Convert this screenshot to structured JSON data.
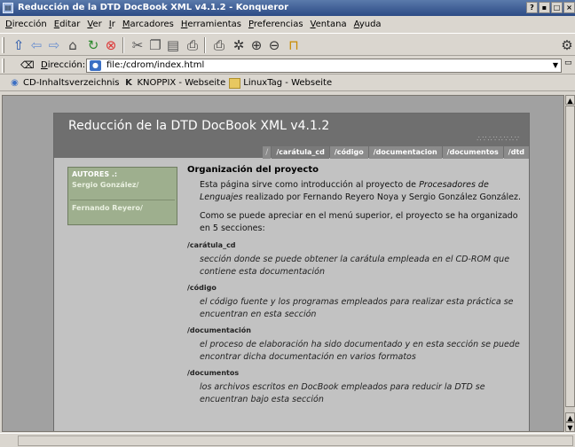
{
  "window": {
    "title": "Reducción de la DTD DocBook XML v4.1.2 - Konqueror",
    "buttons": [
      "?",
      "▪",
      "□",
      "×"
    ]
  },
  "menubar": [
    {
      "u": "D",
      "rest": "irección"
    },
    {
      "u": "E",
      "rest": "ditar"
    },
    {
      "u": "V",
      "rest": "er"
    },
    {
      "u": "I",
      "rest": "r"
    },
    {
      "u": "M",
      "rest": "arcadores"
    },
    {
      "u": "H",
      "rest": "erramientas"
    },
    {
      "u": "P",
      "rest": "referencias"
    },
    {
      "u": "V",
      "rest": "entana"
    },
    {
      "u": "A",
      "rest": "yuda"
    }
  ],
  "toolbar": {
    "icons": [
      "up-arrow-icon",
      "back-arrow-icon",
      "forward-arrow-icon",
      "home-icon",
      "reload-icon",
      "stop-icon",
      "cut-icon",
      "copy-icon",
      "paste-icon",
      "print-icon",
      "print-frame-icon",
      "security-icon",
      "zoom-in-icon",
      "zoom-out-icon",
      "lock-icon"
    ]
  },
  "urlbar": {
    "label_u": "D",
    "label_rest": "irección:",
    "value": "file:/cdrom/index.html"
  },
  "bookmarks": [
    {
      "icon": "cd-icon",
      "label": "CD-Inhaltsverzeichnis"
    },
    {
      "icon": "knoppix-icon",
      "label": "KNOPPIX - Webseite"
    },
    {
      "icon": "folder-icon",
      "label": "LinuxTag - Webseite"
    }
  ],
  "page": {
    "title": "Reducción de la DTD DocBook XML v4.1.2",
    "nav_sep": "/",
    "nav": [
      "/carátula_cd",
      "/código",
      "/documentacion",
      "/documentos",
      "/dtd"
    ],
    "sidebar": {
      "header": "AUTORES .:",
      "authors": [
        "Sergio González/",
        "Fernando Reyero/"
      ]
    },
    "heading": "Organización del proyecto",
    "intro1_pre": "Esta página sirve como introducción al proyecto de ",
    "intro1_em": "Procesadores de Lenguajes",
    "intro1_post": " realizado por Fernando Reyero Noya y Sergio González González.",
    "intro2": "Como se puede apreciar en el menú superior, el proyecto se ha organizado en 5 secciones:",
    "sections": [
      {
        "name": "/carátula_cd",
        "desc": "sección donde se puede obtener la carátula empleada en el CD-ROM que contiene esta documentación"
      },
      {
        "name": "/código",
        "desc": "el código fuente y los programas empleados para realizar esta práctica se encuentran en esta sección"
      },
      {
        "name": "/documentación",
        "desc": "el proceso de elaboración ha sido documentado y en esta sección se puede encontrar dicha documentación en varios formatos"
      },
      {
        "name": "/documentos",
        "desc": "los archivos escritos en DocBook empleados para reducir la DTD se encuentran bajo esta sección"
      }
    ]
  }
}
